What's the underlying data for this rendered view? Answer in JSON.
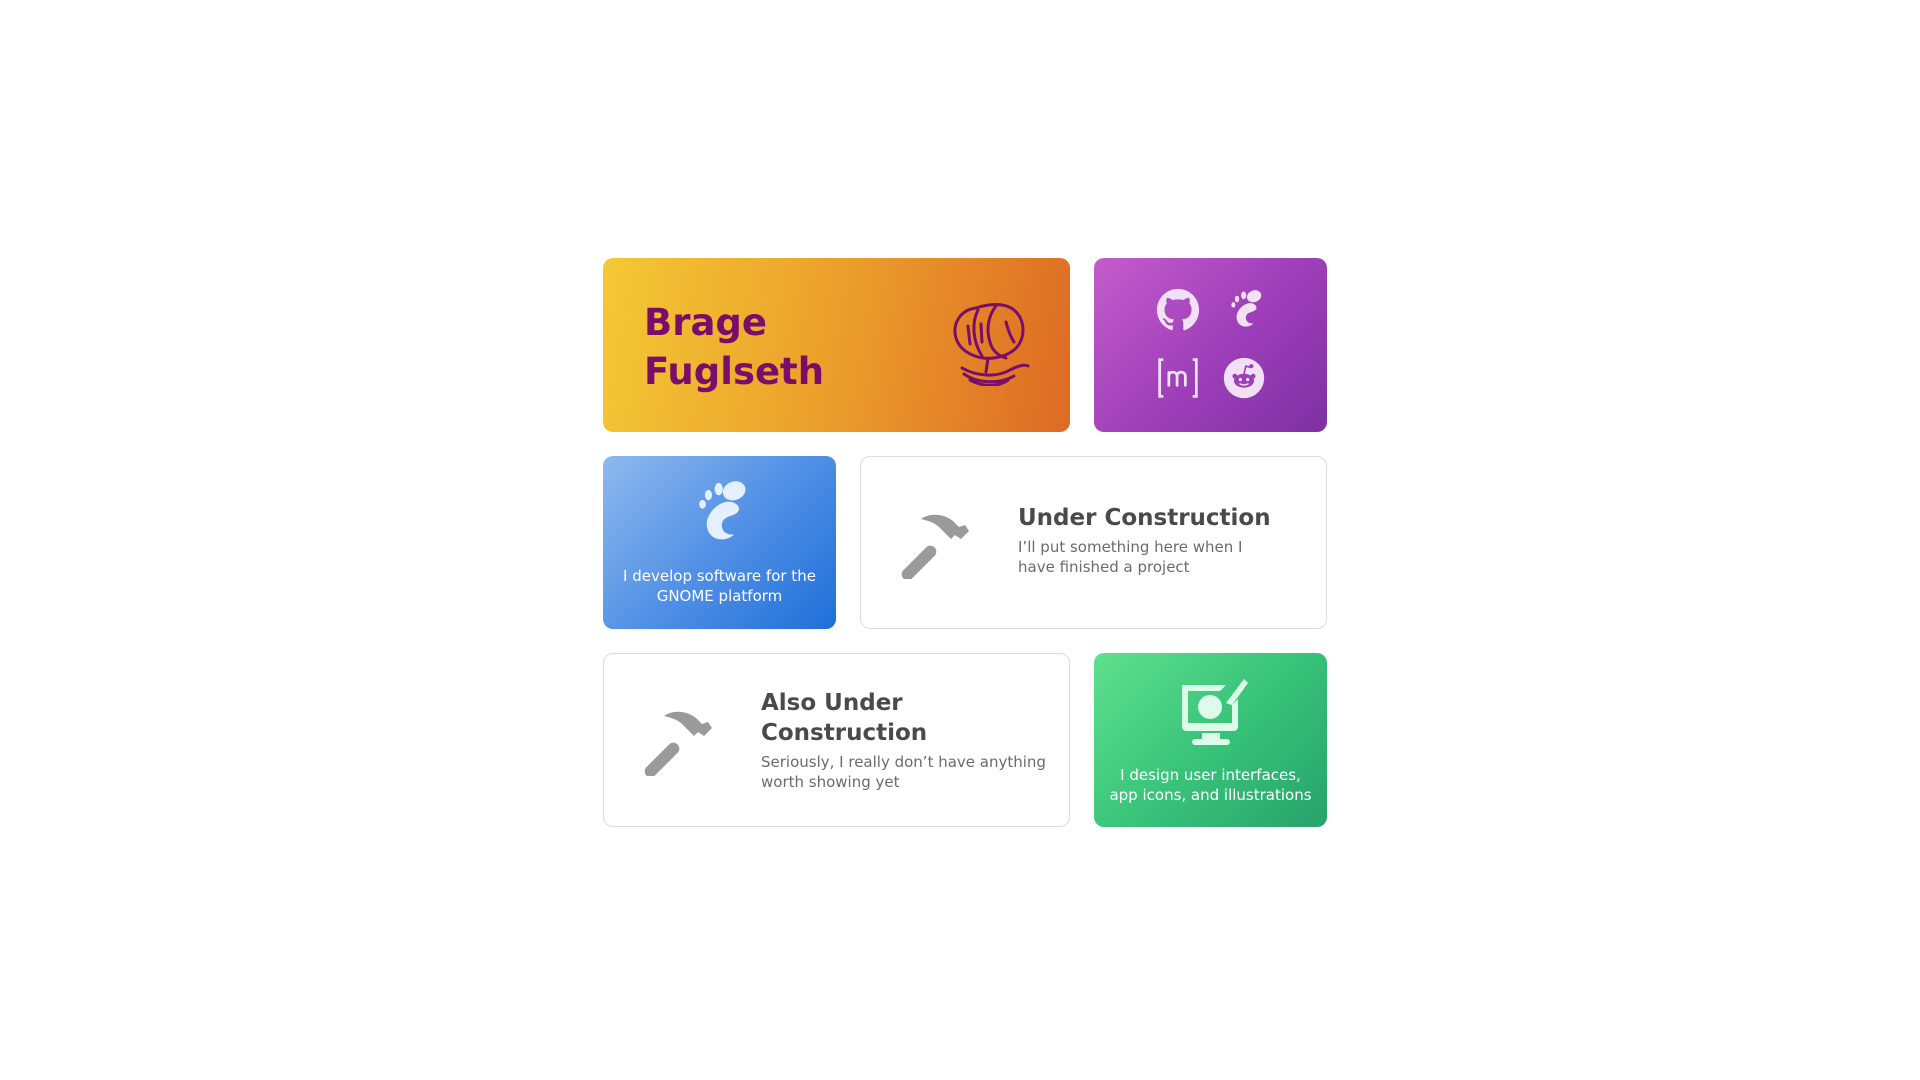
{
  "profile": {
    "name": "Brage Fuglseth",
    "brand_color": "#7b0d6a"
  },
  "social": {
    "links": [
      {
        "icon": "github-icon"
      },
      {
        "icon": "gnome-foot-icon"
      },
      {
        "icon": "matrix-icon"
      },
      {
        "icon": "reddit-icon"
      }
    ]
  },
  "gnome_card": {
    "icon": "gnome-foot-icon",
    "text": "I develop software for the GNOME platform"
  },
  "construction_1": {
    "icon": "hammer-icon",
    "title": "Under Construction",
    "description": "I’ll put something here when I have finished a project"
  },
  "construction_2": {
    "icon": "hammer-icon",
    "title": "Also Under Construction",
    "description": "Seriously, I really don’t have anything worth showing yet"
  },
  "design_card": {
    "icon": "design-monitor-icon",
    "text": "I design user interfaces, app icons, and illustrations"
  },
  "colors": {
    "name_card": [
      "#f4c835",
      "#de6a24"
    ],
    "social_card": [
      "#c45ccc",
      "#7d30a3"
    ],
    "gnome_card": [
      "#8fb9ee",
      "#1f6fd9"
    ],
    "design_card": [
      "#5fe08e",
      "#26a36b"
    ],
    "hammer": "#9a9a9a"
  }
}
